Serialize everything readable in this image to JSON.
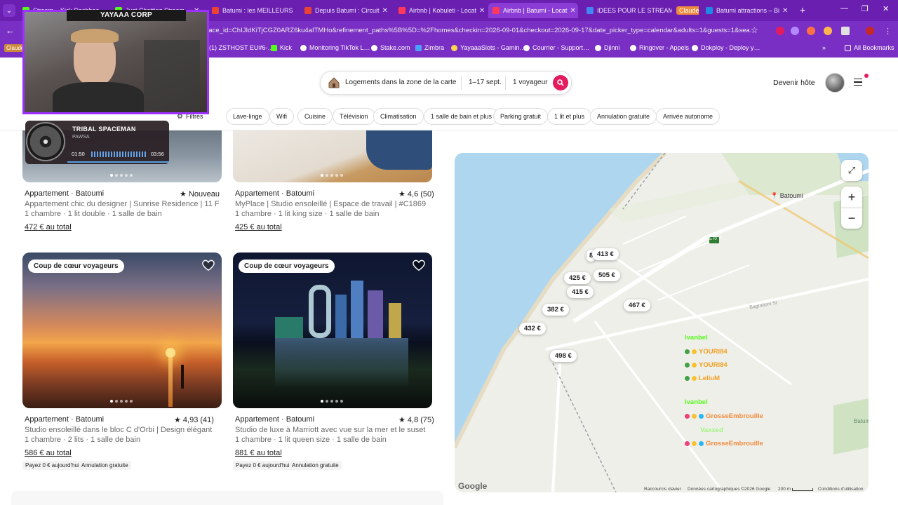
{
  "browser": {
    "tabs": [
      {
        "title": "Stream – Kick Dashboa…",
        "color": "#53fc18"
      },
      {
        "title": "Just Chatting Stream…",
        "color": "#53fc18"
      },
      {
        "title": "Batumi : les MEILLEURS",
        "color": "#ea4335"
      },
      {
        "title": "Depuis Batumi : Circuit",
        "color": "#ea4335"
      },
      {
        "title": "Airbnb | Kobuleti - Locat",
        "color": "#ff385c"
      },
      {
        "title": "Airbnb | Batumi - Locat",
        "color": "#ff385c"
      },
      {
        "title": "IDEES POUR LE STREAM",
        "color": "#4285f4"
      },
      {
        "title": "Claude",
        "color": "#f08a3c"
      },
      {
        "title": "Batumi attractions – Bi",
        "color": "#1e88e5"
      }
    ],
    "url": "place_id=ChIJIdKiTjCGZ0ARZ6ku4aITMHo&refinement_paths%5B%5D=%2Fhomes&checkin=2026-09-01&checkout=2026-09-17&date_picker_type=calendar&adults=1&guests=1&sea…",
    "bookmarks": [
      "(1) ZSTHOST EU#6-…",
      "Kick",
      "Monitoring TikTok L…",
      "Stake.com",
      "Zimbra",
      "YayaaaSlots - Gamin…",
      "Courrier - Support…",
      "Djinni",
      "Ringover - Appels",
      "Dokploy - Deploy y…"
    ],
    "all_bookmarks": "All Bookmarks",
    "claude_bookmark": "Claude"
  },
  "header": {
    "location": "Logements dans la zone de la carte",
    "dates": "1–17 sept.",
    "guests": "1 voyageur",
    "host_link": "Devenir hôte"
  },
  "filters": {
    "filters_label": "Filtres",
    "chips": [
      "Lave-linge",
      "Wifi",
      "Cuisine",
      "Télévision",
      "Climatisation",
      "1 salle de bain et plus",
      "Parking gratuit",
      "1 lit et plus",
      "Annulation gratuite",
      "Arrivée autonome"
    ]
  },
  "listings": [
    {
      "type": "Appartement · Batoumi",
      "rating": "★ Nouveau",
      "title": "Appartement chic du designer | Sunrise Residence | 11 F",
      "beds": "1 chambre · 1 lit double · 1 salle de bain",
      "price": "472 € au total"
    },
    {
      "type": "Appartement · Batoumi",
      "rating": "★ 4,6 (50)",
      "title": "MyPlace | Studio ensoleillé | Espace de travail | #C1869",
      "beds": "1 chambre · 1 lit king size · 1 salle de bain",
      "price": "425 € au total"
    },
    {
      "type": "Appartement · Batoumi",
      "rating": "★ 4,93 (41)",
      "title": "Studio ensoleillé dans le bloc C d'Orbi | Design élégant",
      "beds": "1 chambre · 2 lits · 1 salle de bain",
      "price": "586 € au total",
      "badge": "Coup de cœur voyageurs",
      "chips": [
        "Payez 0 € aujourd'hui",
        "Annulation gratuite"
      ]
    },
    {
      "type": "Appartement · Batoumi",
      "rating": "★ 4,8 (75)",
      "title": "Studio de luxe à Marriott avec vue sur la mer et le suset",
      "beds": "1 chambre · 1 lit queen size · 1 salle de bain",
      "price": "881 € au total",
      "badge": "Coup de cœur voyageurs",
      "chips": [
        "Payez 0 € aujourd'hui",
        "Annulation gratuite"
      ]
    }
  ],
  "map": {
    "city_label": "Batoumi",
    "pins": [
      "413 €",
      "505 €",
      "425 €",
      "415 €",
      "467 €",
      "382 €",
      "432 €",
      "498 €",
      "8"
    ],
    "footer": [
      "Raccourcis clavier",
      "Données cartographiques ©2026 Google",
      "200 m",
      "Conditions d'utilisation"
    ],
    "google": "Google",
    "road_label": "E70",
    "street_label": "Bagrationi St",
    "edge_label": "Batumi V"
  },
  "overlay": {
    "webcam_title": "YAYAAA CORP",
    "music": {
      "title": "TRIBAL SPACEMAN",
      "artist": "PAWSA",
      "elapsed": "01:50",
      "total": "03:56"
    },
    "chat": [
      {
        "user": "Ivanbel",
        "color": "#53fc18"
      },
      {
        "user": "YOURI84",
        "color": "#f0a020"
      },
      {
        "user": "YOURI84",
        "color": "#f0a020"
      },
      {
        "user": "LeliuM",
        "color": "#f0a020"
      },
      {
        "user": "Ivanbel",
        "color": "#53fc18"
      },
      {
        "user": "GrosseEmbrouille",
        "color": "#f08a3c"
      },
      {
        "user": "Vaxxed",
        "color": "#53fc18"
      },
      {
        "user": "GrosseEmbrouille",
        "color": "#f08a3c"
      }
    ]
  }
}
